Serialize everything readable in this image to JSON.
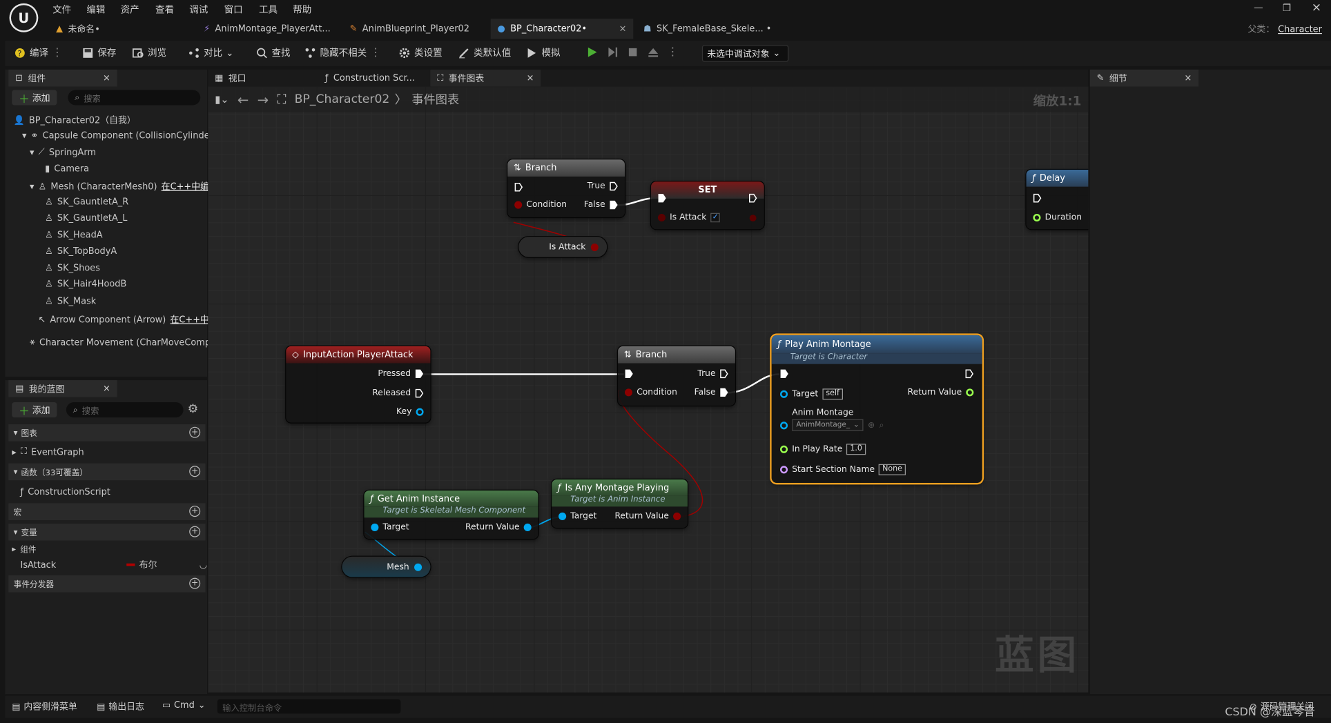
{
  "menu": [
    "文件",
    "编辑",
    "资产",
    "查看",
    "调试",
    "窗口",
    "工具",
    "帮助"
  ],
  "doc_tabs": [
    {
      "label": "未命名•"
    },
    {
      "label": "AnimMontage_PlayerAtt..."
    },
    {
      "label": "AnimBlueprint_Player02"
    },
    {
      "label": "BP_Character02•"
    },
    {
      "label": "SK_FemaleBase_Skele... •"
    }
  ],
  "parent_class": {
    "label": "父类：",
    "value": "Character"
  },
  "toolbar": {
    "compile": "编译",
    "save": "保存",
    "browse": "浏览",
    "diff": "对比",
    "find": "查找",
    "hide_unrelated": "隐藏不相关",
    "class_settings": "类设置",
    "class_defaults": "类默认值",
    "simulate": "模拟",
    "debug_target": "未选中调试对象"
  },
  "components_panel": {
    "tab": "组件",
    "add": "添加",
    "search_placeholder": "搜索",
    "items": [
      {
        "label": "BP_Character02（自我）"
      },
      {
        "label": "Capsule Component (CollisionCylinder)"
      },
      {
        "label": "SpringArm"
      },
      {
        "label": "Camera"
      },
      {
        "label": "Mesh (CharacterMesh0)",
        "note": "在C++中编辑"
      },
      {
        "label": "SK_GauntletA_R"
      },
      {
        "label": "SK_GauntletA_L"
      },
      {
        "label": "SK_HeadA"
      },
      {
        "label": "SK_TopBodyA"
      },
      {
        "label": "SK_Shoes"
      },
      {
        "label": "SK_Hair4HoodB"
      },
      {
        "label": "SK_Mask"
      },
      {
        "label": "Arrow Component (Arrow)",
        "note": "在C++中编"
      },
      {
        "label": "Character Movement (CharMoveComp)"
      }
    ]
  },
  "my_blueprint": {
    "tab": "我的蓝图",
    "add": "添加",
    "search_placeholder": "搜索",
    "graphs": "图表",
    "event_graph": "EventGraph",
    "functions": "函数（33可覆盖）",
    "construction_script": "ConstructionScript",
    "macros": "宏",
    "variables": "变量",
    "components": "组件",
    "var_name": "IsAttack",
    "var_type": "布尔",
    "dispatchers": "事件分发器"
  },
  "editor_tabs": {
    "viewport": "视口",
    "construction": "Construction Scr...",
    "event_graph": "事件图表"
  },
  "breadcrumb": {
    "blueprint": "BP_Character02",
    "graph": "事件图表",
    "zoom": "缩放1:1"
  },
  "details_panel": {
    "tab": "细节"
  },
  "nodes": {
    "branch1": {
      "title": "Branch",
      "true": "True",
      "condition": "Condition",
      "false": "False"
    },
    "set": {
      "title": "SET",
      "var": "Is Attack"
    },
    "delay": {
      "title": "Delay",
      "duration": "Duration"
    },
    "is_attack_get": {
      "label": "Is Attack"
    },
    "input_action": {
      "title": "InputAction PlayerAttack",
      "pressed": "Pressed",
      "released": "Released",
      "key": "Key"
    },
    "branch2": {
      "title": "Branch",
      "true": "True",
      "condition": "Condition",
      "false": "False"
    },
    "play_montage": {
      "title": "Play Anim Montage",
      "subtitle": "Target is Character",
      "target": "Target",
      "target_val": "self",
      "return": "Return Value",
      "anim_montage": "Anim Montage",
      "montage_val": "AnimMontage_",
      "play_rate": "In Play Rate",
      "play_rate_val": "1.0",
      "section": "Start Section Name",
      "section_val": "None"
    },
    "get_anim": {
      "title": "Get Anim Instance",
      "subtitle": "Target is Skeletal Mesh Component",
      "target": "Target",
      "return": "Return Value"
    },
    "is_playing": {
      "title": "Is Any Montage Playing",
      "subtitle": "Target is Anim Instance",
      "target": "Target",
      "return": "Return Value"
    },
    "mesh_get": {
      "label": "Mesh"
    }
  },
  "watermark": "蓝图",
  "statusbar": {
    "content_drawer": "内容侧滑菜单",
    "output_log": "输出日志",
    "cmd": "Cmd",
    "console_placeholder": "输入控制台命令",
    "source_control": "源码管理关闭",
    "credit": "CSDN @深蓝琴音"
  },
  "colors": {
    "exec": "#ffffff",
    "bool": "#8c0000",
    "object": "#00a8f0",
    "float": "#9aff4e",
    "name": "#cc99ff",
    "selected_border": "#f0a020"
  }
}
